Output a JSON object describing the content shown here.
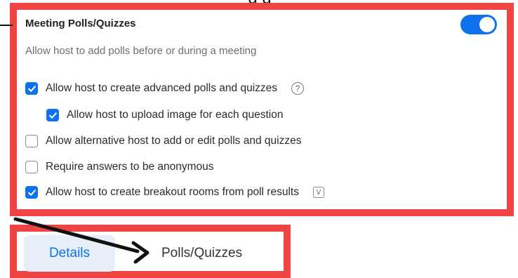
{
  "caption_fragment": "g        g",
  "settings": {
    "title": "Meeting Polls/Quizzes",
    "description": "Allow host to add polls before or during a meeting",
    "toggle_on": true,
    "options": [
      {
        "label": "Allow host to create advanced polls and quizzes",
        "checked": true,
        "icon": "help-icon",
        "icon_glyph": "?"
      },
      {
        "label": "Allow host to upload image for each question",
        "checked": true
      },
      {
        "label": "Allow alternative host to add or edit polls and quizzes",
        "checked": false
      },
      {
        "label": "Require answers to be anonymous",
        "checked": false
      },
      {
        "label": "Allow host to create breakout rooms from poll results",
        "checked": true,
        "icon": "version-badge-icon",
        "icon_glyph": "V"
      }
    ]
  },
  "tabs": {
    "details": "Details",
    "polls": "Polls/Quizzes"
  },
  "colors": {
    "accent": "#0e72ed",
    "annotation_border": "#ee4444",
    "tab_active_bg": "#e6eef9"
  }
}
